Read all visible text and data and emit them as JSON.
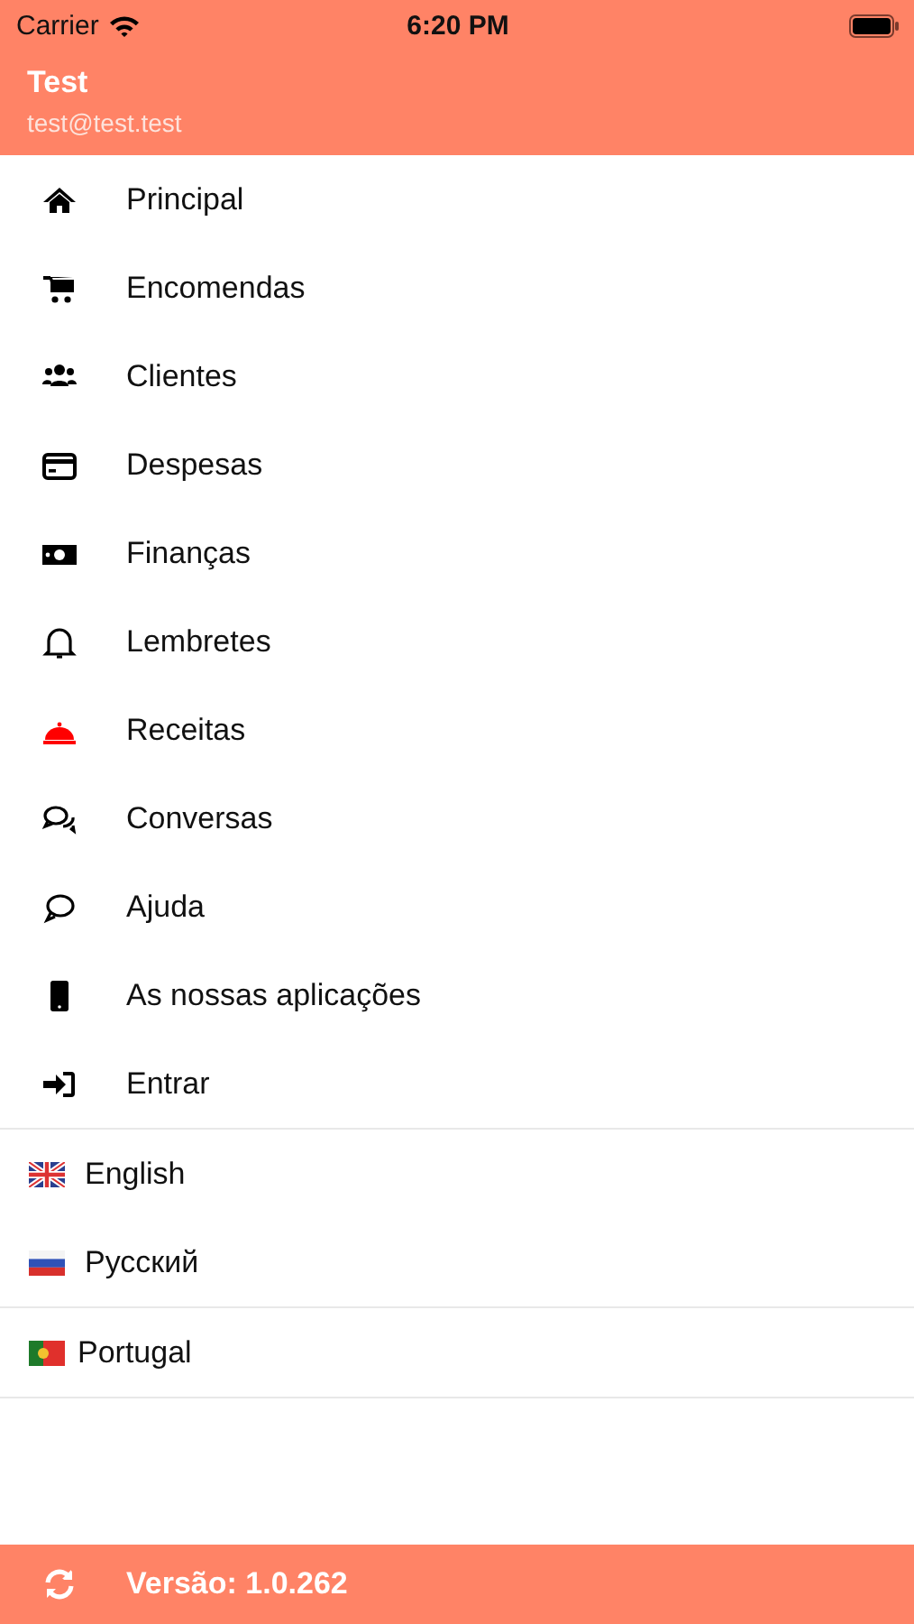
{
  "status_bar": {
    "carrier": "Carrier",
    "time": "6:20 PM"
  },
  "user": {
    "name": "Test",
    "email": "test@test.test"
  },
  "menu": [
    {
      "label": "Principal",
      "color": "#000000"
    },
    {
      "label": "Encomendas",
      "color": "#000000"
    },
    {
      "label": "Clientes",
      "color": "#000000"
    },
    {
      "label": "Despesas",
      "color": "#000000"
    },
    {
      "label": "Finanças",
      "color": "#000000"
    },
    {
      "label": "Lembretes",
      "color": "#000000"
    },
    {
      "label": "Receitas",
      "color": "#ff0000"
    },
    {
      "label": "Conversas",
      "color": "#000000"
    },
    {
      "label": "Ajuda",
      "color": "#000000"
    },
    {
      "label": "As nossas aplicações",
      "color": "#000000"
    },
    {
      "label": "Entrar",
      "color": "#000000"
    }
  ],
  "languages": [
    [
      {
        "label": "English"
      },
      {
        "label": "Русский"
      }
    ],
    [
      {
        "label": "Portugal"
      }
    ]
  ],
  "footer": {
    "version": "Versão: 1.0.262"
  }
}
